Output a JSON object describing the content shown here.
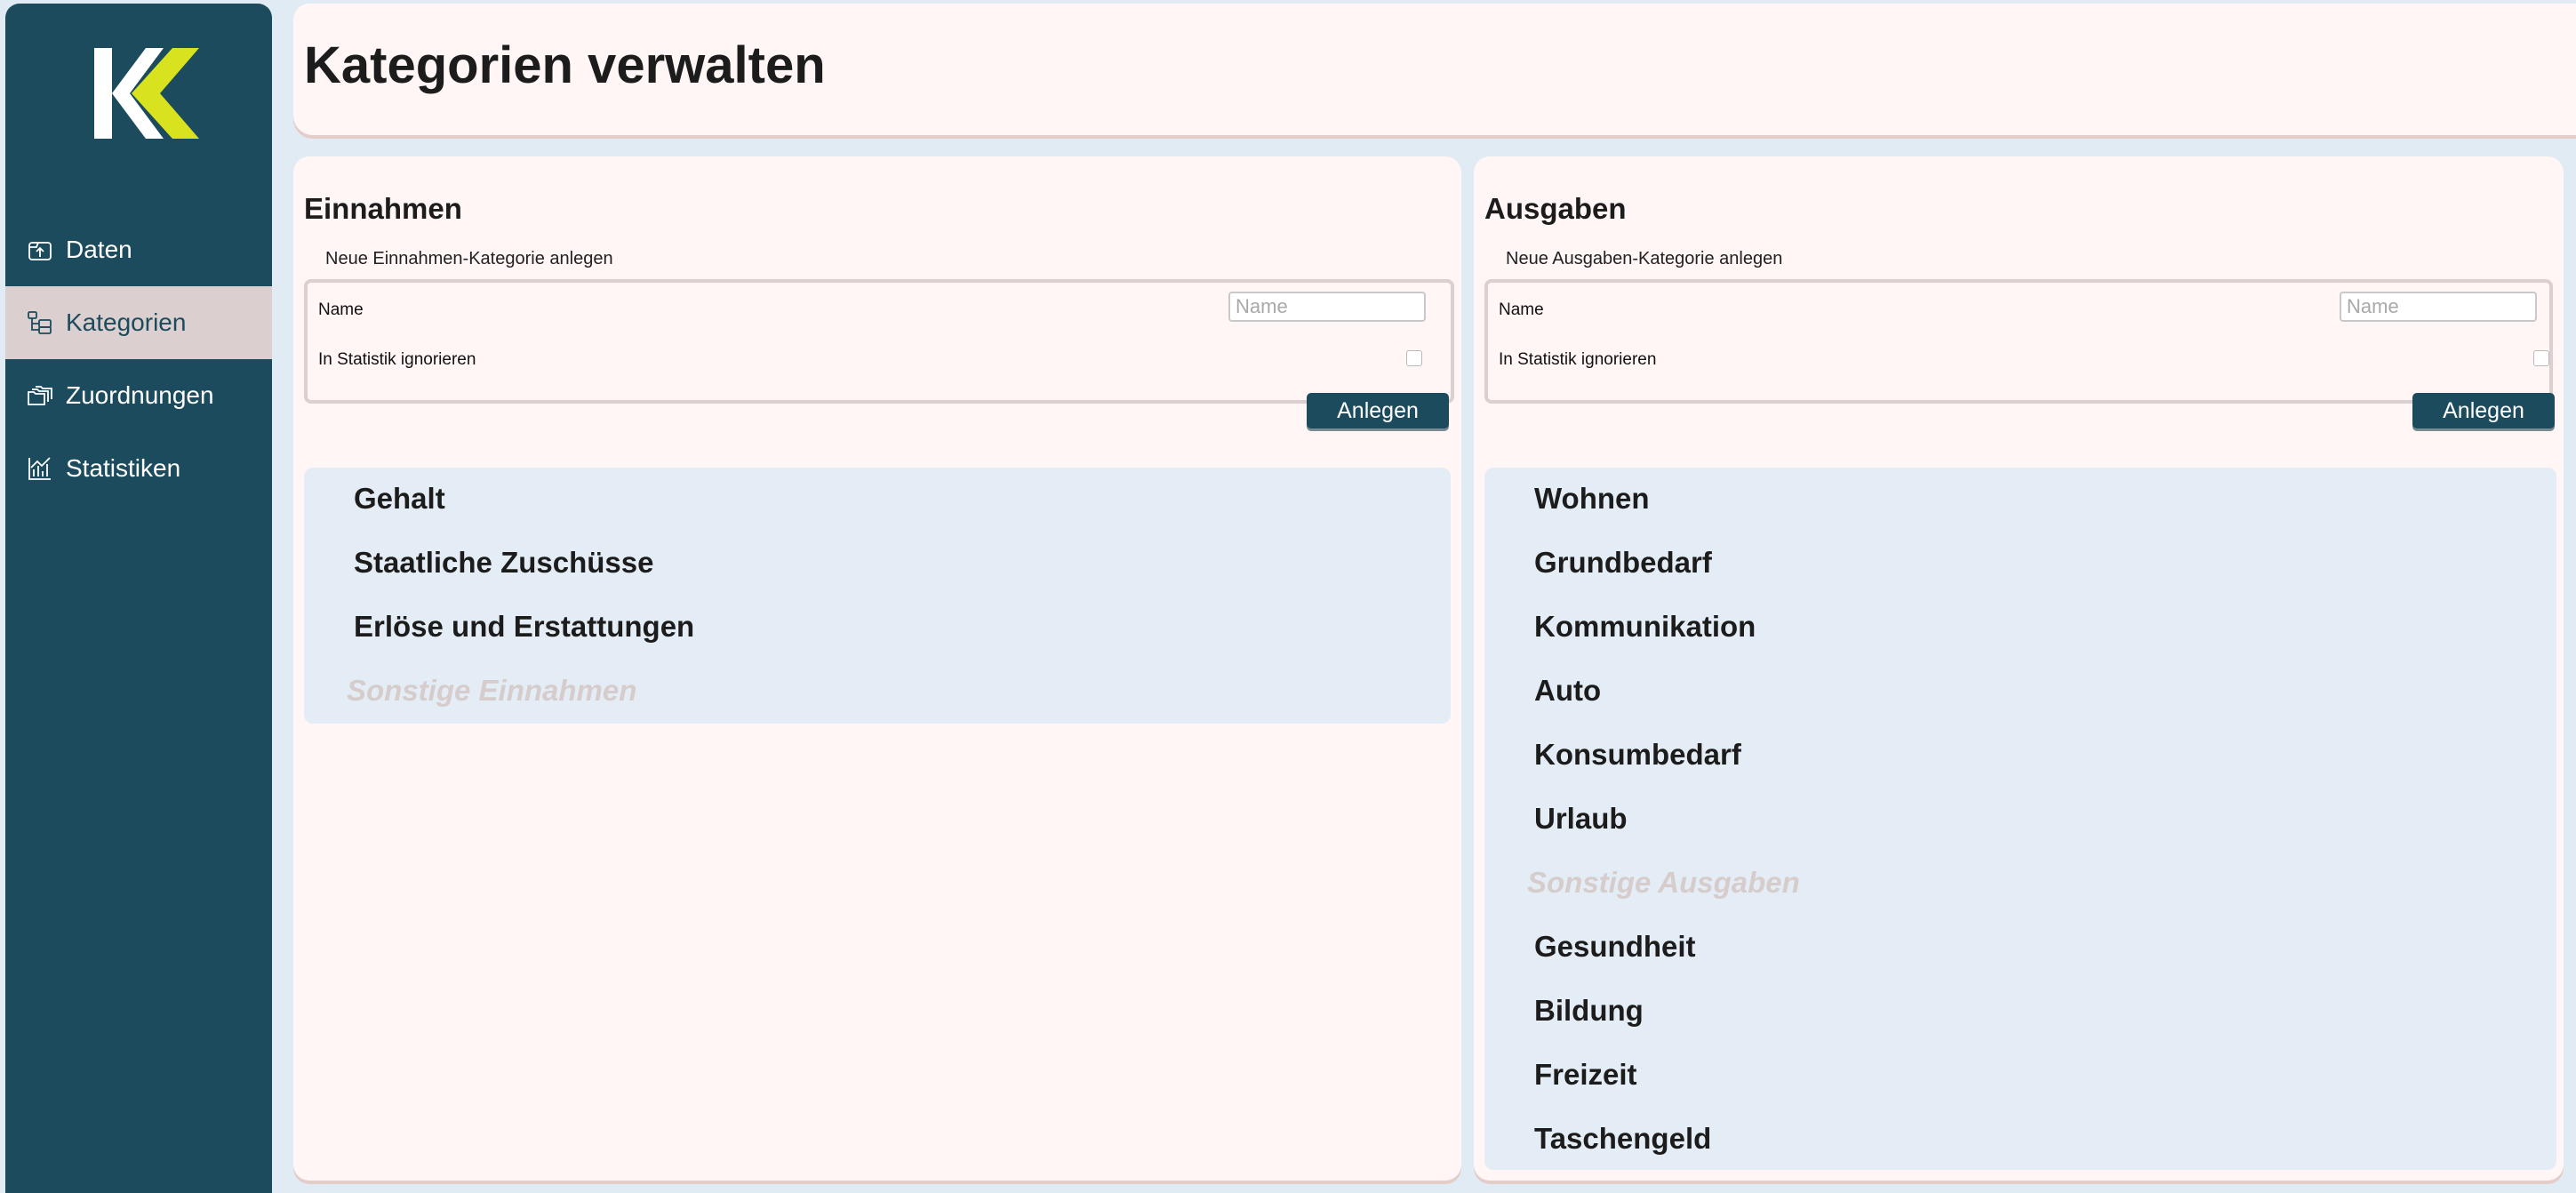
{
  "app": {
    "logo_text": "KK",
    "brand_colors": {
      "primary": "#1b4b5c",
      "accent": "#d9e21f",
      "active_nav_bg": "#dccfd0",
      "muted_text": "#d6cccc"
    }
  },
  "sidebar": {
    "items": [
      {
        "label": "Daten",
        "icon": "upload-box-icon",
        "active": false
      },
      {
        "label": "Kategorien",
        "icon": "category-tree-icon",
        "active": true
      },
      {
        "label": "Zuordnungen",
        "icon": "folders-icon",
        "active": false
      },
      {
        "label": "Statistiken",
        "icon": "chart-icon",
        "active": false
      }
    ]
  },
  "header": {
    "title": "Kategorien verwalten"
  },
  "income": {
    "title": "Einnahmen",
    "form_legend": "Neue Einnahmen-Kategorie anlegen",
    "name_label": "Name",
    "name_placeholder": "Name",
    "name_value": "",
    "ignore_label": "In Statistik ignorieren",
    "ignore_checked": false,
    "submit_label": "Anlegen",
    "categories": [
      {
        "label": "Gehalt",
        "muted": false
      },
      {
        "label": "Staatliche Zuschüsse",
        "muted": false
      },
      {
        "label": "Erlöse und Erstattungen",
        "muted": false
      },
      {
        "label": "Sonstige Einnahmen",
        "muted": true
      }
    ]
  },
  "expenses": {
    "title": "Ausgaben",
    "form_legend": "Neue Ausgaben-Kategorie anlegen",
    "name_label": "Name",
    "name_placeholder": "Name",
    "name_value": "",
    "ignore_label": "In Statistik ignorieren",
    "ignore_checked": false,
    "submit_label": "Anlegen",
    "categories": [
      {
        "label": "Wohnen",
        "muted": false
      },
      {
        "label": "Grundbedarf",
        "muted": false
      },
      {
        "label": "Kommunikation",
        "muted": false
      },
      {
        "label": "Auto",
        "muted": false
      },
      {
        "label": "Konsumbedarf",
        "muted": false
      },
      {
        "label": "Urlaub",
        "muted": false
      },
      {
        "label": "Sonstige Ausgaben",
        "muted": true
      },
      {
        "label": "Gesundheit",
        "muted": false
      },
      {
        "label": "Bildung",
        "muted": false
      },
      {
        "label": "Freizeit",
        "muted": false
      },
      {
        "label": "Taschengeld",
        "muted": false
      }
    ]
  }
}
